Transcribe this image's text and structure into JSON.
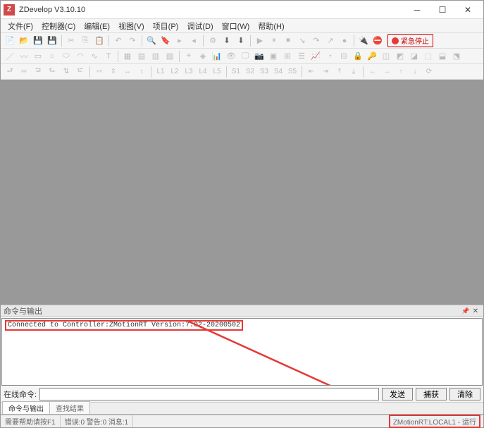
{
  "window": {
    "title": "ZDevelop V3.10.10",
    "icon_letter": "Z"
  },
  "menu": {
    "items": [
      "文件(F)",
      "控制器(C)",
      "编辑(E)",
      "视图(V)",
      "项目(P)",
      "调试(D)",
      "窗口(W)",
      "帮助(H)"
    ]
  },
  "toolbar1": {
    "estop_label": "紧急停止"
  },
  "guide_labels": [
    "L1",
    "L2",
    "L3",
    "L4",
    "L5",
    "S1",
    "S2",
    "S3",
    "S4",
    "S5"
  ],
  "panel": {
    "title": "命令与输出",
    "output_line1": "Connected to Controller:ZMotionRT Version:7.02-20200502"
  },
  "cmd": {
    "label": "在线命令:",
    "send": "发送",
    "capture": "捕获",
    "clear": "清除"
  },
  "tabs": {
    "t1": "命令与输出",
    "t2": "查找结果"
  },
  "status": {
    "help": "需要帮助请按F1",
    "counts": "错误:0 警告:0 消息:1",
    "connection": "ZMotionRT:LOCAL1 - 运行"
  }
}
